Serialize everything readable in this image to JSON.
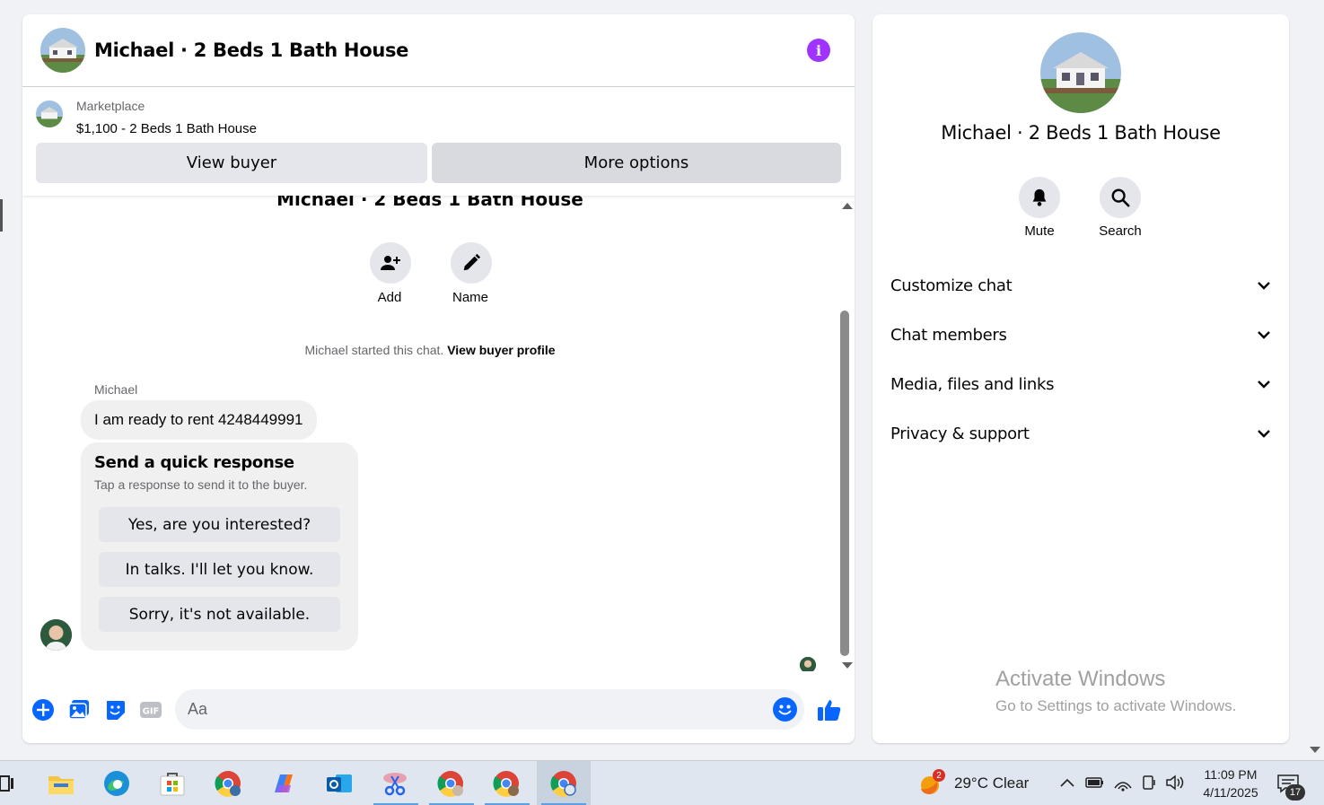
{
  "header": {
    "title": "Michael · 2 Beds 1 Bath House"
  },
  "listing": {
    "source": "Marketplace",
    "price_title": "$1,100 - 2 Beds 1 Bath House",
    "view_buyer_label": "View buyer",
    "more_options_label": "More options"
  },
  "chat": {
    "faded_title": "Michael · 2 Beds 1 Bath House",
    "actions": [
      {
        "label": "Add",
        "icon": "add-person-icon"
      },
      {
        "label": "Name",
        "icon": "pencil-icon"
      }
    ],
    "system_text": "Michael started this chat.",
    "system_link": "View buyer profile",
    "sender_name": "Michael",
    "message": "I am ready to rent 4248449991",
    "quick_response": {
      "title": "Send a quick response",
      "subtitle": "Tap a response to send it to the buyer.",
      "options": [
        "Yes, are you interested?",
        "In talks. I'll let you know.",
        "Sorry, it's not available."
      ]
    }
  },
  "composer": {
    "placeholder": "Aa"
  },
  "info_panel": {
    "title": "Michael · 2 Beds 1 Bath House",
    "actions": [
      {
        "label": "Mute",
        "icon": "bell-icon"
      },
      {
        "label": "Search",
        "icon": "search-icon"
      }
    ],
    "sections": [
      "Customize chat",
      "Chat members",
      "Media, files and links",
      "Privacy & support"
    ],
    "watermark_line1": "Activate Windows",
    "watermark_line2": "Go to Settings to activate Windows."
  },
  "taskbar": {
    "weather_badge": "2",
    "weather": "29°C  Clear",
    "time": "11:09 PM",
    "date": "4/11/2025",
    "notifications": "17"
  },
  "colors": {
    "accent": "#0866ff",
    "info": "#a033ff",
    "bubble": "#f0f0f0",
    "button": "#e4e6eb"
  }
}
